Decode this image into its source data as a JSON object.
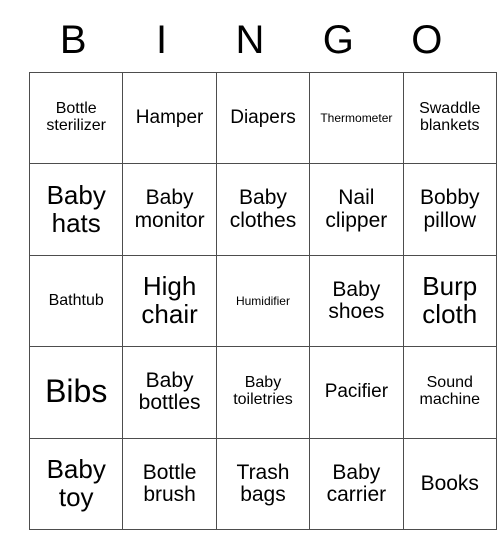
{
  "card": {
    "title_letters": [
      "B",
      "I",
      "N",
      "G",
      "O"
    ],
    "rows": [
      [
        {
          "text": "Bottle sterilizer",
          "size": "xs"
        },
        {
          "text": "Hamper",
          "size": "sm"
        },
        {
          "text": "Diapers",
          "size": "sm"
        },
        {
          "text": "Thermometer",
          "size": "xxs"
        },
        {
          "text": "Swaddle blankets",
          "size": "xs"
        }
      ],
      [
        {
          "text": "Baby hats",
          "size": "lg"
        },
        {
          "text": "Baby monitor",
          "size": "md"
        },
        {
          "text": "Baby clothes",
          "size": "md"
        },
        {
          "text": "Nail clipper",
          "size": "md"
        },
        {
          "text": "Bobby pillow",
          "size": "md"
        }
      ],
      [
        {
          "text": "Bathtub",
          "size": "xs"
        },
        {
          "text": "High chair",
          "size": "lg"
        },
        {
          "text": "Humidifier",
          "size": "xxs"
        },
        {
          "text": "Baby shoes",
          "size": "md"
        },
        {
          "text": "Burp cloth",
          "size": "lg"
        }
      ],
      [
        {
          "text": "Bibs",
          "size": "xl"
        },
        {
          "text": "Baby bottles",
          "size": "md"
        },
        {
          "text": "Baby toiletries",
          "size": "xs"
        },
        {
          "text": "Pacifier",
          "size": "sm"
        },
        {
          "text": "Sound machine",
          "size": "xs"
        }
      ],
      [
        {
          "text": "Baby toy",
          "size": "lg"
        },
        {
          "text": "Bottle brush",
          "size": "md"
        },
        {
          "text": "Trash bags",
          "size": "md"
        },
        {
          "text": "Baby carrier",
          "size": "md"
        },
        {
          "text": "Books",
          "size": "md"
        }
      ]
    ]
  },
  "colors": {
    "background": "#ffffff",
    "text": "#000000",
    "grid_border": "#4d4d4d"
  }
}
